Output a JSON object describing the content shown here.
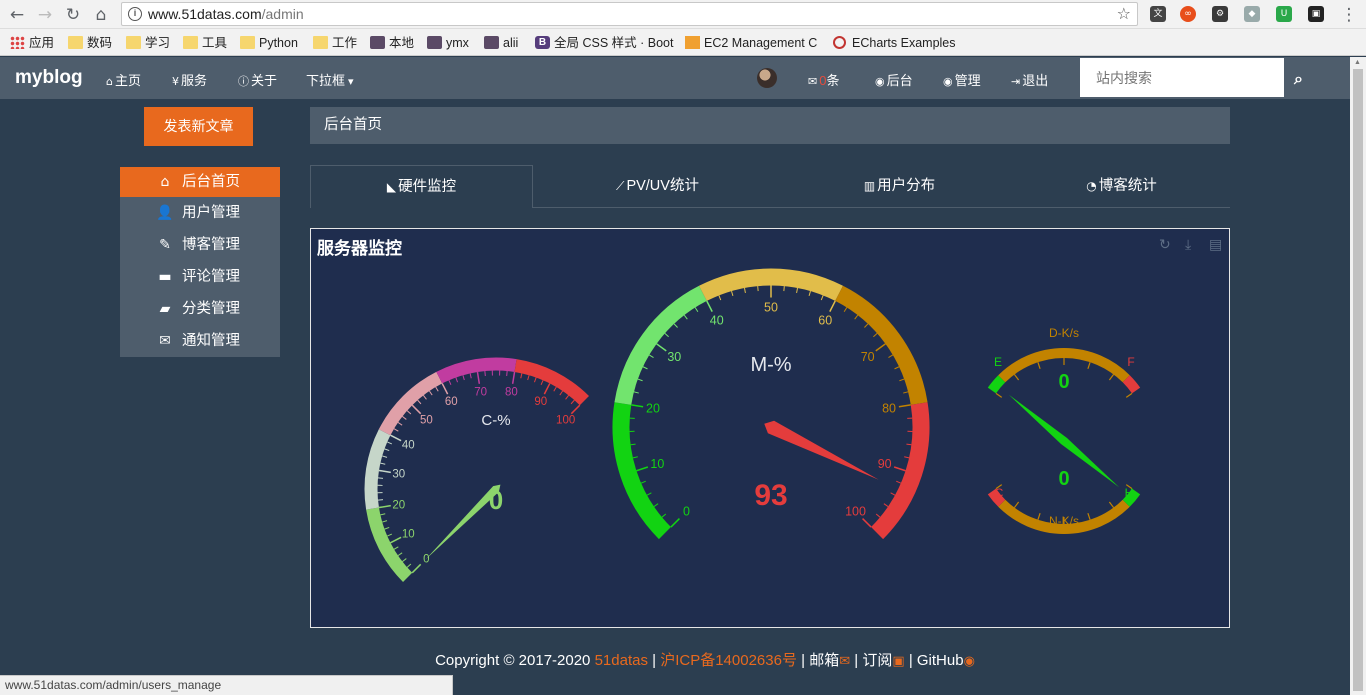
{
  "browser": {
    "url_host": "www.51datas.com",
    "url_path": "/admin",
    "bookmarks": [
      "应用",
      "数码",
      "学习",
      "工具",
      "Python",
      "工作",
      "本地",
      "ymx",
      "alii",
      "全局 CSS 样式 · Boot",
      "EC2 Management C",
      "ECharts Examples"
    ],
    "status_url": "www.51datas.com/admin/users_manage"
  },
  "navbar": {
    "brand": "myblog",
    "items": [
      {
        "icon": "home-icon",
        "label": "主页"
      },
      {
        "icon": "cutlery-icon",
        "label": "服务"
      },
      {
        "icon": "info-icon",
        "label": "关于"
      },
      {
        "icon": "",
        "label": "下拉框"
      }
    ],
    "mail_count": "0",
    "mail_unit": "条",
    "right_items": [
      {
        "icon": "user-circle-icon",
        "label": "后台"
      },
      {
        "icon": "user-circle-icon",
        "label": "管理"
      },
      {
        "icon": "sign-out-icon",
        "label": "退出"
      }
    ],
    "search_placeholder": "站内搜索"
  },
  "sidebar": {
    "new_post": "发表新文章",
    "items": [
      {
        "icon": "home-icon",
        "label": "后台首页",
        "active": true
      },
      {
        "icon": "user-icon",
        "label": "用户管理"
      },
      {
        "icon": "pencil-icon",
        "label": "博客管理"
      },
      {
        "icon": "comment-icon",
        "label": "评论管理"
      },
      {
        "icon": "folder-open-icon",
        "label": "分类管理"
      },
      {
        "icon": "envelope-icon",
        "label": "通知管理"
      }
    ]
  },
  "main": {
    "breadcrumb": "后台首页",
    "tabs": [
      {
        "icon": "area-chart-icon",
        "label": "硬件监控",
        "active": true
      },
      {
        "icon": "line-chart-icon",
        "label": "PV/UV统计"
      },
      {
        "icon": "bar-chart-icon",
        "label": "用户分布"
      },
      {
        "icon": "pie-chart-icon",
        "label": "博客统计"
      }
    ]
  },
  "chart_data": {
    "type": "gauge",
    "title": "服务器监控",
    "gauges": [
      {
        "name": "C-%",
        "value": 0,
        "min": 0,
        "max": 100,
        "ticks": [
          0,
          10,
          20,
          30,
          40,
          50,
          60,
          70,
          80,
          90,
          100
        ],
        "bands": [
          {
            "to": 0.2,
            "color": "#8cd46c"
          },
          {
            "to": 0.4,
            "color": "#c6d6c9"
          },
          {
            "to": 0.6,
            "color": "#e0a0a8"
          },
          {
            "to": 0.8,
            "color": "#c13ca0"
          },
          {
            "to": 1.0,
            "color": "#e43c3c"
          }
        ]
      },
      {
        "name": "M-%",
        "value": 93,
        "min": 0,
        "max": 100,
        "ticks": [
          0,
          10,
          20,
          30,
          40,
          50,
          60,
          70,
          80,
          90,
          100
        ],
        "bands": [
          {
            "to": 0.2,
            "color": "#12d312"
          },
          {
            "to": 0.4,
            "color": "#72e46e"
          },
          {
            "to": 0.6,
            "color": "#e1bd4a"
          },
          {
            "to": 0.8,
            "color": "#c28300"
          },
          {
            "to": 1.0,
            "color": "#e43c3c"
          }
        ]
      },
      {
        "name": "D-K/s",
        "value": 0,
        "range_labels": [
          "E",
          "F"
        ]
      },
      {
        "name": "N-K/s",
        "value": 0,
        "range_labels": [
          "C",
          "H"
        ]
      }
    ]
  },
  "footer": {
    "copyright": "Copyright © 2017-2020",
    "site": "51datas",
    "icp": "沪ICP备14002636号",
    "mail": "邮箱",
    "rss": "订阅",
    "github": "GitHub"
  }
}
